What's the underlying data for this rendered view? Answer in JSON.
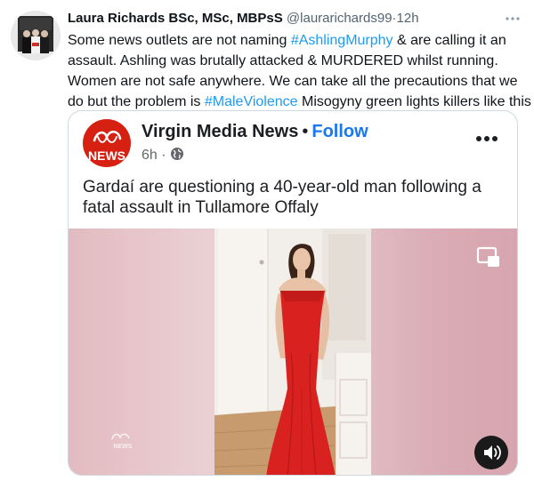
{
  "tweet": {
    "author_name": "Laura Richards BSc, MSc, MBPsS",
    "author_handle": "@laurarichards99",
    "separator": "·",
    "time": "12h",
    "text_parts": [
      {
        "text": "Some news outlets are not naming ",
        "hashtag": false
      },
      {
        "text": "#AshlingMurphy",
        "hashtag": true
      },
      {
        "text": " & are calling it an",
        "hashtag": false
      },
      {
        "text": "assault. Ashling was brutally attacked & MURDERED whilst running.",
        "hashtag": false
      },
      {
        "text": "Women are not safe anywhere. We can take all the precautions that we",
        "hashtag": false
      },
      {
        "text": "do but the problem is ",
        "hashtag": false
      },
      {
        "text": "#MaleViolence",
        "hashtag": true
      },
      {
        "text": " Misogyny green lights killers like this",
        "hashtag": false
      }
    ]
  },
  "card": {
    "logo_text": "NEWS",
    "page_name": "Virgin Media News",
    "name_dot": "•",
    "follow_label": "Follow",
    "time": "6h",
    "meta_dot": "·",
    "headline": "Gardaí are questioning a 40-year-old man following a fatal assault in Tullamore Offaly",
    "watermark": "NEWS"
  },
  "colors": {
    "hashtag": "#1d9bf0",
    "follow": "#1877f2",
    "brand_red": "#d62012",
    "dress_red": "#d9211f"
  },
  "icons": {
    "more": "more-horizontal-icon",
    "card_more": "more-dots-icon",
    "globe": "globe-icon",
    "pip": "picture-in-picture-icon",
    "sound": "speaker-icon"
  }
}
